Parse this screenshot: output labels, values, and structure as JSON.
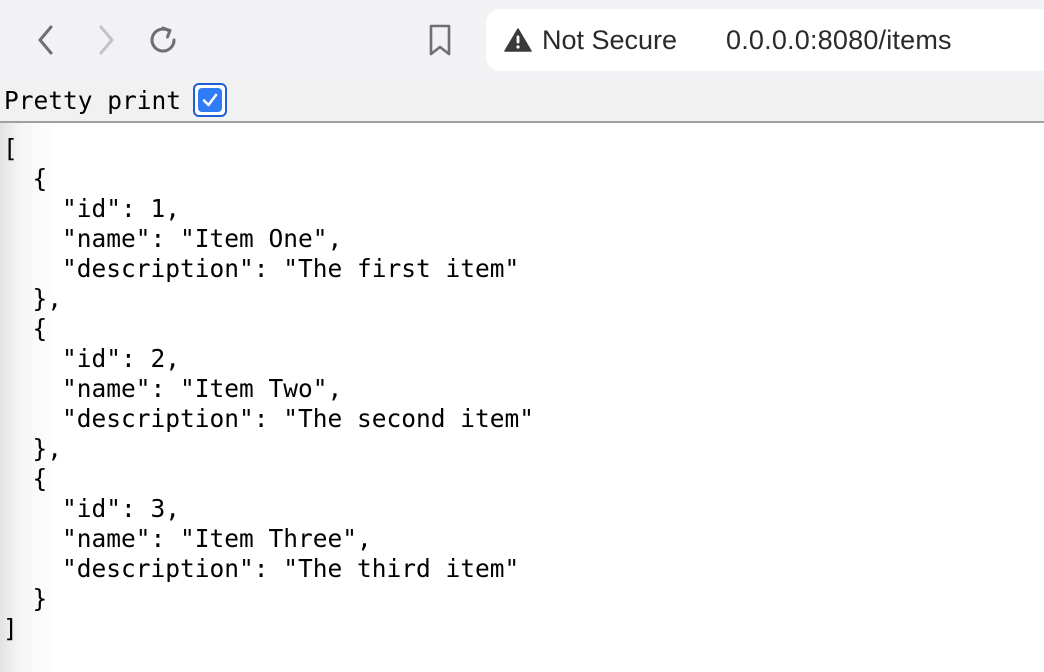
{
  "toolbar": {
    "back_icon": "chevron-left-icon",
    "forward_icon": "chevron-right-icon",
    "reload_icon": "reload-icon",
    "bookmark_icon": "bookmark-icon"
  },
  "address": {
    "security_icon": "warning-triangle-icon",
    "security_label": "Not Secure",
    "url": "0.0.0.0:8080/items"
  },
  "pretty_print": {
    "label": "Pretty print",
    "checked": true
  },
  "json_lines": [
    "[",
    "  {",
    "    \"id\": 1,",
    "    \"name\": \"Item One\",",
    "    \"description\": \"The first item\"",
    "  },",
    "  {",
    "    \"id\": 2,",
    "    \"name\": \"Item Two\",",
    "    \"description\": \"The second item\"",
    "  },",
    "  {",
    "    \"id\": 3,",
    "    \"name\": \"Item Three\",",
    "    \"description\": \"The third item\"",
    "  }",
    "]"
  ],
  "colors": {
    "toolbar_bg": "#f2f2f4",
    "checkbox_accent": "#2f7cf6"
  }
}
